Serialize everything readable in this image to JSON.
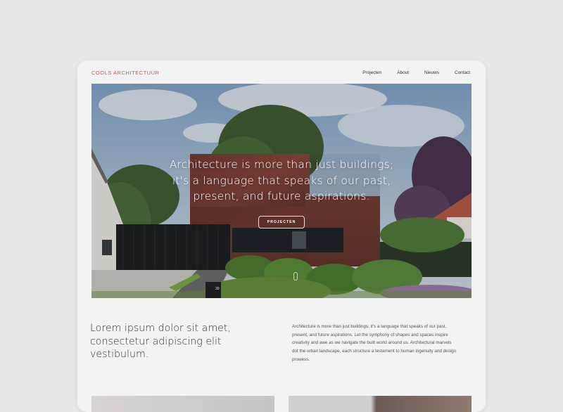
{
  "brand": "COOLS ARCHITECTUUR",
  "nav": {
    "items": [
      "Projecten",
      "About",
      "Nieuws",
      "Contact"
    ]
  },
  "hero": {
    "headline_line1": "Architecture is more than just buildings;",
    "headline_line2": "it's a language that speaks of our past,",
    "headline_line3": "present, and future aspirations.",
    "button_label": "PROJECTEN",
    "house_number": "30"
  },
  "intro": {
    "heading": "Lorem ipsum dolor sit amet, consectetur adipiscing elit vestibulum.",
    "body": "Architecture is more than just buildings; it's a language that speaks of our past, present, and future aspirations. Let the symphony of shapes and spaces inspire creativity and awe as we navigate the built world around us. Architectural marvels dot the urban landscape, each structure a testament to human ingenuity and design prowess."
  },
  "colors": {
    "brand_accent": "#d6504a",
    "page_background": "#e8e8e8",
    "card_background": "#f3f3f3"
  }
}
